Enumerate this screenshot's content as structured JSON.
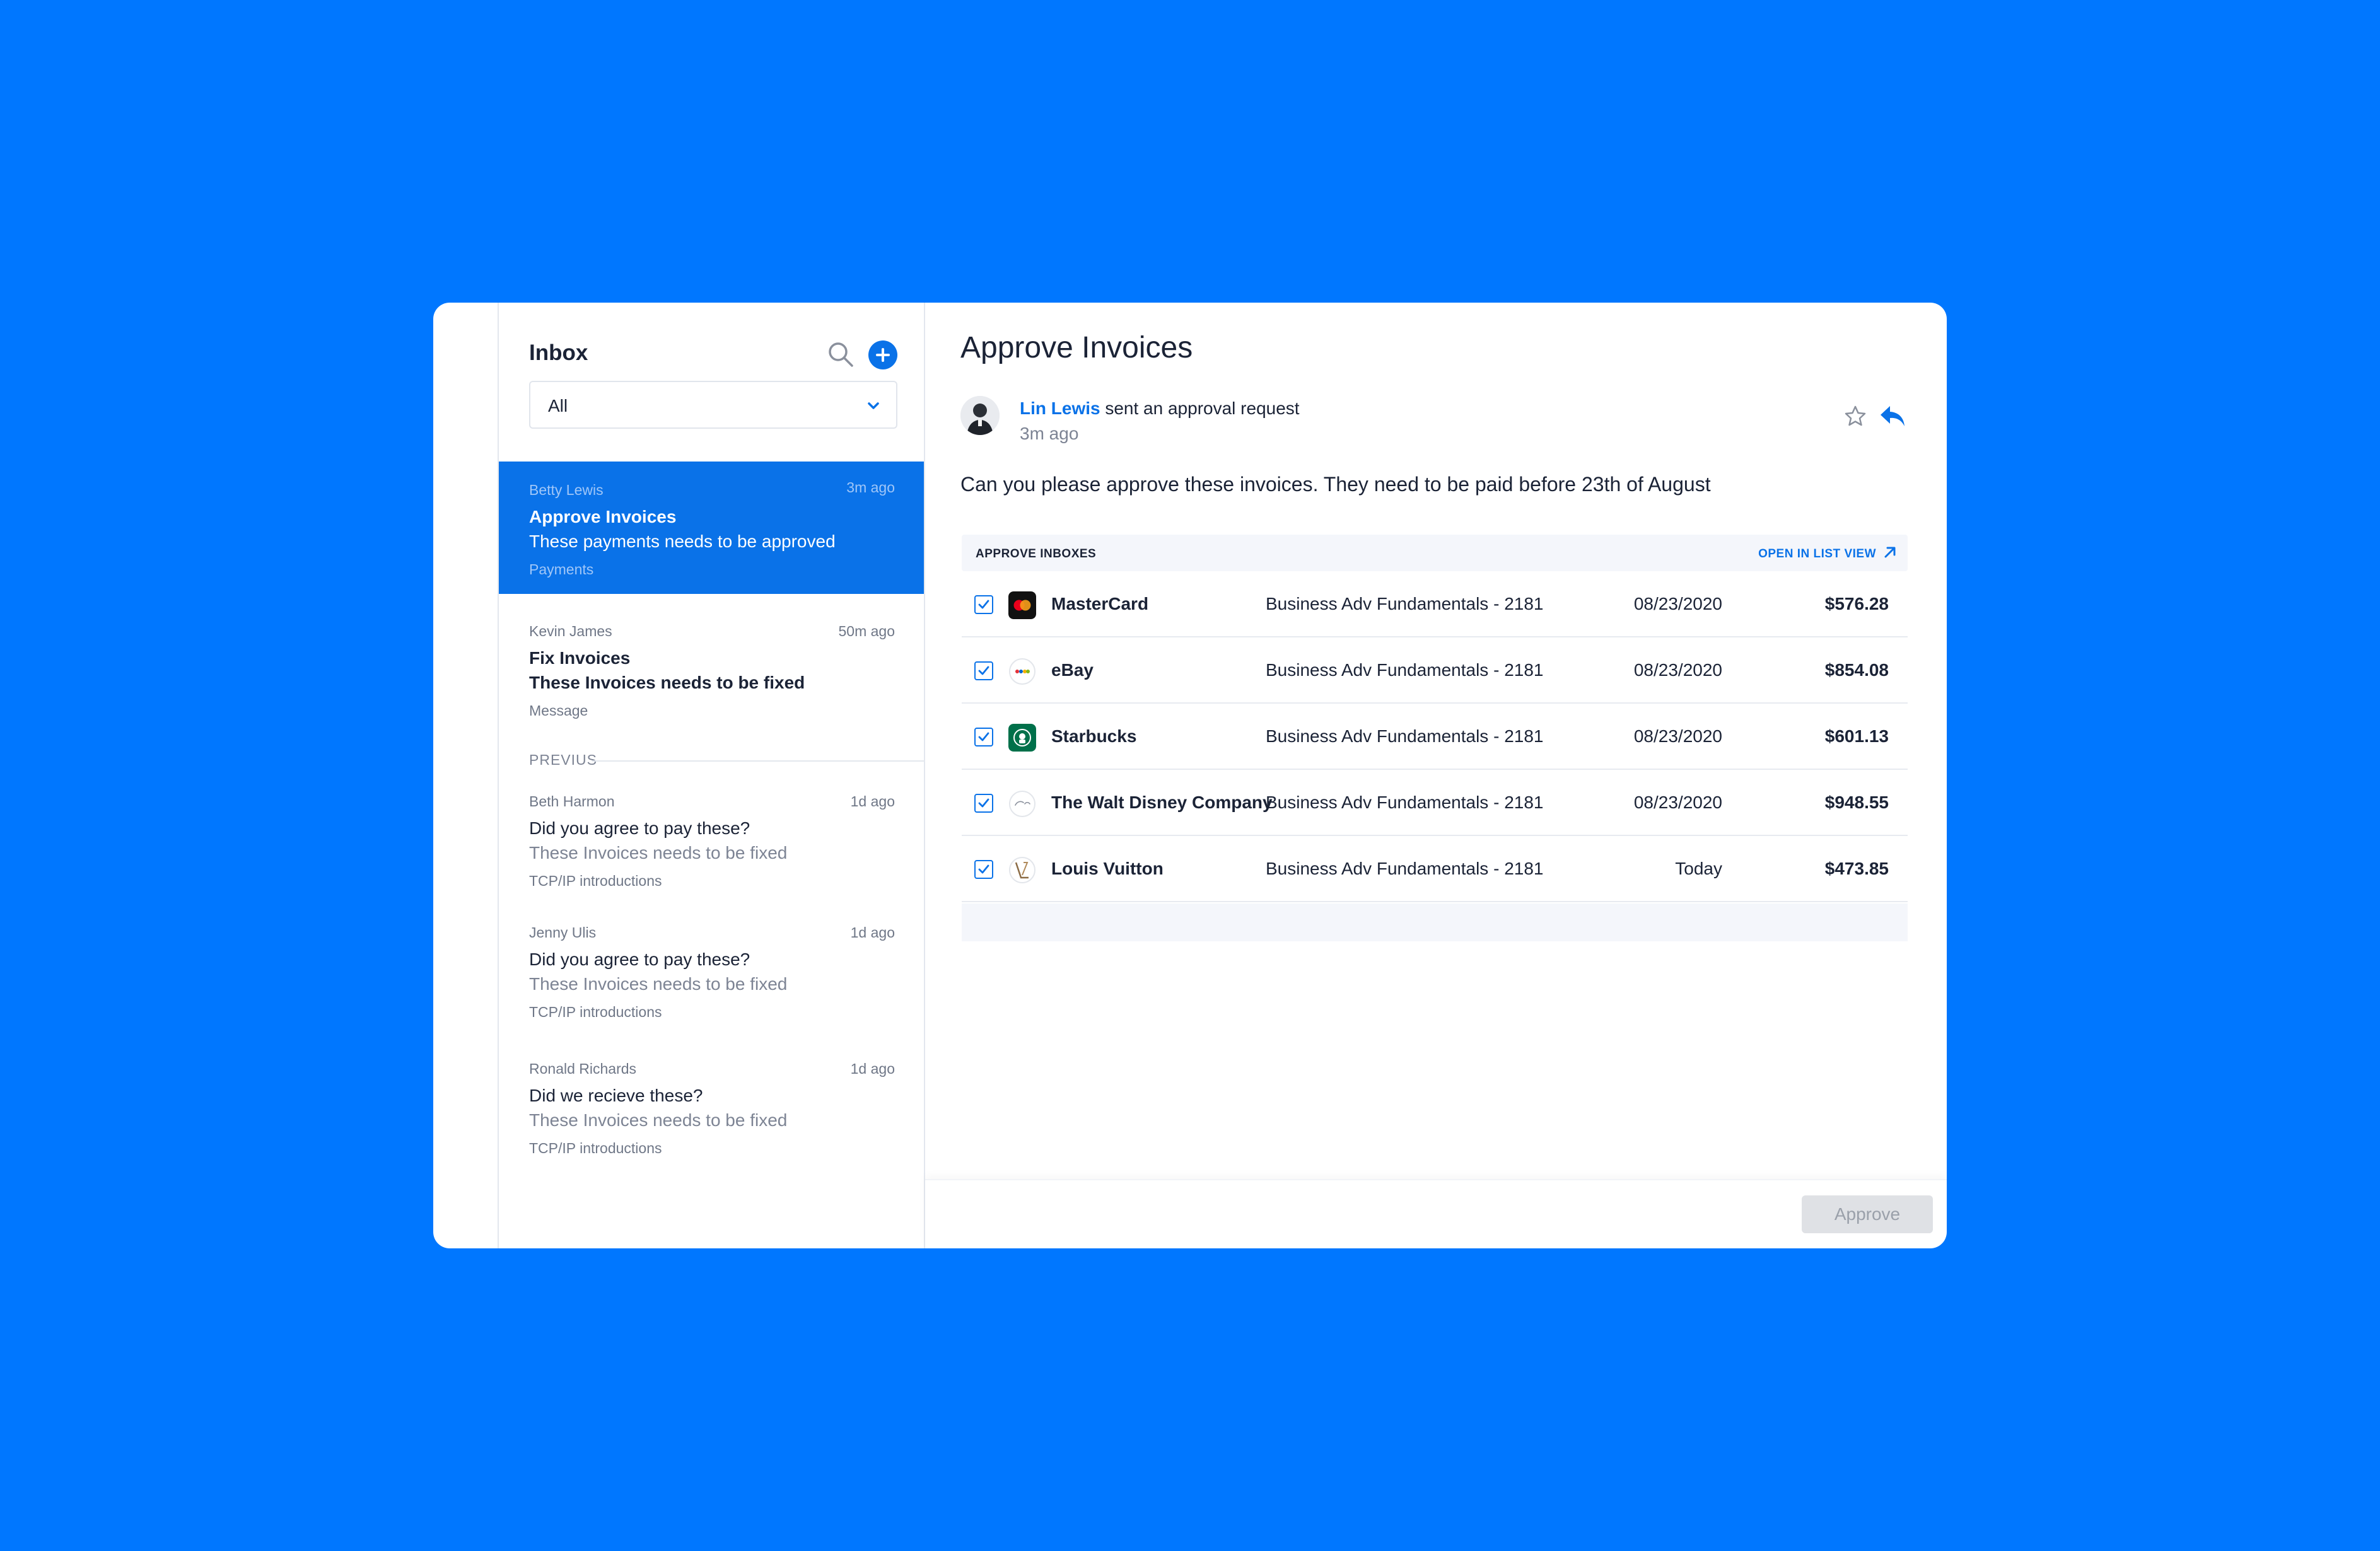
{
  "inbox": {
    "title": "Inbox",
    "filter": "All",
    "messages": [
      {
        "sender": "Betty Lewis",
        "time": "3m ago",
        "subject": "Approve Invoices",
        "preview": "These payments needs to be approved",
        "tag": "Payments"
      },
      {
        "sender": "Kevin James",
        "time": "50m ago",
        "subject": "Fix Invoices",
        "preview": "These Invoices needs to be fixed",
        "tag": "Message"
      }
    ],
    "section_label": "PREVIUS",
    "previous": [
      {
        "sender": "Beth Harmon",
        "time": "1d ago",
        "subject": "Did you agree to pay these?",
        "preview": "These Invoices needs to be fixed",
        "tag": "TCP/IP introductions"
      },
      {
        "sender": "Jenny Ulis",
        "time": "1d ago",
        "subject": "Did you agree to pay these?",
        "preview": "These Invoices needs to be fixed",
        "tag": "TCP/IP introductions"
      },
      {
        "sender": "Ronald Richards",
        "time": "1d ago",
        "subject": "Did we recieve these?",
        "preview": "These Invoices needs to be fixed",
        "tag": "TCP/IP introductions"
      }
    ]
  },
  "detail": {
    "title": "Approve Invoices",
    "sender_name": "Lin Lewis",
    "sender_action": " sent an approval request",
    "sent_time": "3m ago",
    "body": "Can you please approve these invoices. They need to be paid before 23th of August",
    "table": {
      "header": "APPROVE INBOXES",
      "open_link": "OPEN IN LIST VIEW",
      "rows": [
        {
          "vendor": "MasterCard",
          "account": "Business Adv Fundamentals - 2181",
          "date": "08/23/2020",
          "amount": "$576.28"
        },
        {
          "vendor": "eBay",
          "account": "Business Adv Fundamentals - 2181",
          "date": "08/23/2020",
          "amount": "$854.08"
        },
        {
          "vendor": "Starbucks",
          "account": "Business Adv Fundamentals - 2181",
          "date": "08/23/2020",
          "amount": "$601.13"
        },
        {
          "vendor": "The Walt Disney Company",
          "account": "Business Adv Fundamentals - 2181",
          "date": "08/23/2020",
          "amount": "$948.55"
        },
        {
          "vendor": "Louis Vuitton",
          "account": "Business Adv Fundamentals - 2181",
          "date": "Today",
          "amount": "$473.85"
        }
      ]
    },
    "approve_label": "Approve"
  },
  "colors": {
    "background": "#0077ff",
    "accent": "#0a72e8",
    "text": "#1b2336",
    "muted": "#7d8494"
  }
}
